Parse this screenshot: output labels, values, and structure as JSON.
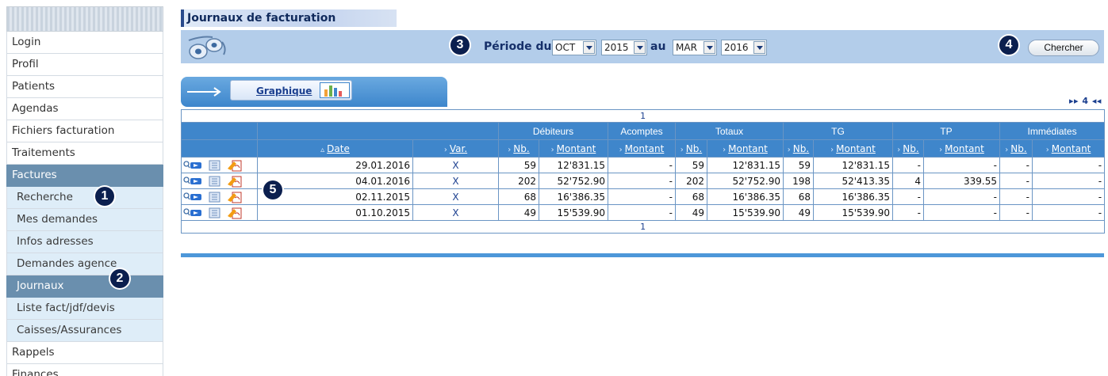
{
  "sidebar": {
    "items": [
      {
        "label": "Login",
        "type": "main"
      },
      {
        "label": "Profil",
        "type": "main"
      },
      {
        "label": "Patients",
        "type": "main"
      },
      {
        "label": "Agendas",
        "type": "main"
      },
      {
        "label": "Fichiers facturation",
        "type": "main"
      },
      {
        "label": "Traitements",
        "type": "main"
      },
      {
        "label": "Factures",
        "type": "main",
        "active": true
      },
      {
        "label": "Recherche",
        "type": "sub"
      },
      {
        "label": "Mes demandes",
        "type": "sub"
      },
      {
        "label": "Infos adresses",
        "type": "sub"
      },
      {
        "label": "Demandes agence",
        "type": "sub"
      },
      {
        "label": "Journaux",
        "type": "sub",
        "active": true
      },
      {
        "label": "Liste fact/jdf/devis",
        "type": "sub"
      },
      {
        "label": "Caisses/Assurances",
        "type": "sub"
      },
      {
        "label": "Rappels",
        "type": "main"
      },
      {
        "label": "Finances",
        "type": "main"
      }
    ]
  },
  "badges": {
    "b1": "1",
    "b2": "2",
    "b3": "3",
    "b4": "4",
    "b5": "5"
  },
  "header": {
    "title": "Journaux de facturation",
    "periode_du": "Période du",
    "au": "au",
    "from_month": "OCT",
    "from_year": "2015",
    "to_month": "MAR",
    "to_year": "2016",
    "search_button": "Chercher"
  },
  "graph_tab": {
    "label": "Graphique"
  },
  "pager": {
    "top": "▸▸ 4 ◂◂",
    "page": "1"
  },
  "table": {
    "group_headers": [
      "Débiteurs",
      "Acomptes",
      "Totaux",
      "TG",
      "TP",
      "Immédiates"
    ],
    "col_headers": {
      "date": "Date",
      "var": "Var.",
      "nb": "Nb.",
      "montant": "Montant"
    },
    "sort_up": "▵",
    "sort_right": "›",
    "rows": [
      {
        "date": "29.01.2016",
        "var": "X",
        "deb_nb": "59",
        "deb_montant": "12'831.15",
        "acompte": "-",
        "tot_nb": "59",
        "tot_montant": "12'831.15",
        "tg_nb": "59",
        "tg_montant": "12'831.15",
        "tp_nb": "-",
        "tp_montant": "-",
        "imm_nb": "-",
        "imm_montant": "-"
      },
      {
        "date": "04.01.2016",
        "var": "X",
        "deb_nb": "202",
        "deb_montant": "52'752.90",
        "acompte": "-",
        "tot_nb": "202",
        "tot_montant": "52'752.90",
        "tg_nb": "198",
        "tg_montant": "52'413.35",
        "tp_nb": "4",
        "tp_montant": "339.55",
        "imm_nb": "-",
        "imm_montant": "-"
      },
      {
        "date": "02.11.2015",
        "var": "X",
        "deb_nb": "68",
        "deb_montant": "16'386.35",
        "acompte": "-",
        "tot_nb": "68",
        "tot_montant": "16'386.35",
        "tg_nb": "68",
        "tg_montant": "16'386.35",
        "tp_nb": "-",
        "tp_montant": "-",
        "imm_nb": "-",
        "imm_montant": "-"
      },
      {
        "date": "01.10.2015",
        "var": "X",
        "deb_nb": "49",
        "deb_montant": "15'539.90",
        "acompte": "-",
        "tot_nb": "49",
        "tot_montant": "15'539.90",
        "tg_nb": "49",
        "tg_montant": "15'539.90",
        "tp_nb": "-",
        "tp_montant": "-",
        "imm_nb": "-",
        "imm_montant": "-"
      }
    ]
  },
  "colors": {
    "header_blue": "#3f86cb",
    "sidebar_active": "#6a8fae",
    "badge": "#0b1f4e",
    "period_bar": "#b3cdea"
  }
}
